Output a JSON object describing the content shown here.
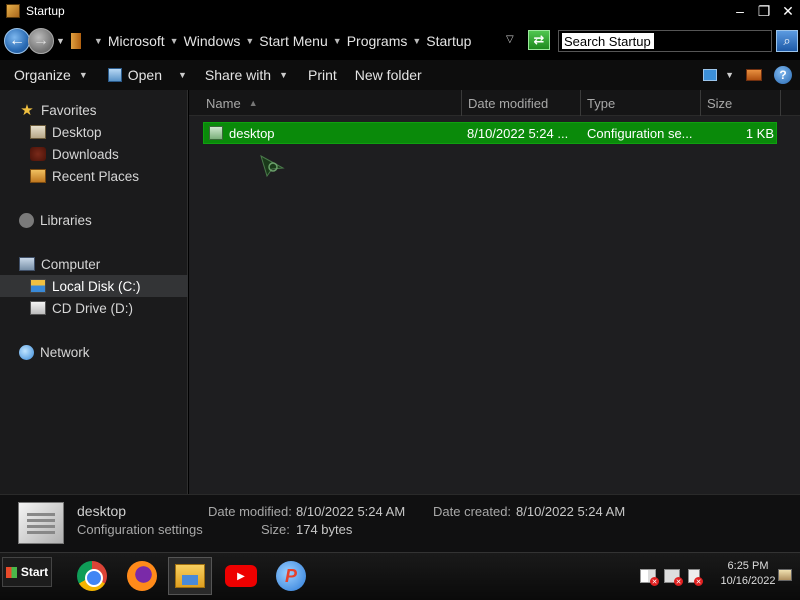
{
  "window": {
    "title": "Startup"
  },
  "address": {
    "crumbs": [
      "Microsoft",
      "Windows",
      "Start Menu",
      "Programs",
      "Startup"
    ],
    "search_value": "Search Startup"
  },
  "toolbar": {
    "organize": "Organize",
    "open": "Open",
    "share_with": "Share with",
    "print": "Print",
    "new_folder": "New folder"
  },
  "sidebar": {
    "favorites": "Favorites",
    "desktop": "Desktop",
    "downloads": "Downloads",
    "recent_places": "Recent Places",
    "libraries": "Libraries",
    "computer": "Computer",
    "local_disk": "Local Disk (C:)",
    "cd_drive": "CD Drive (D:)",
    "network": "Network"
  },
  "columns": {
    "name": "Name",
    "date_modified": "Date modified",
    "type": "Type",
    "size": "Size"
  },
  "files": [
    {
      "name": "desktop",
      "date_modified": "8/10/2022 5:24 ...",
      "type": "Configuration se...",
      "size": "1 KB"
    }
  ],
  "details": {
    "name": "desktop",
    "type": "Configuration settings",
    "date_modified_label": "Date modified:",
    "date_modified": "8/10/2022 5:24 AM",
    "date_created_label": "Date created:",
    "date_created": "8/10/2022 5:24 AM",
    "size_label": "Size:",
    "size": "174 bytes"
  },
  "taskbar": {
    "start": "Start",
    "apps": [
      "chrome-icon",
      "firefox-icon",
      "file-explorer-icon",
      "youtube-icon",
      "p-app-icon"
    ],
    "time": "6:25 PM",
    "date": "10/16/2022"
  },
  "colors": {
    "selection_green": "#0a8a0a",
    "window_bg": "#1e1e20"
  }
}
